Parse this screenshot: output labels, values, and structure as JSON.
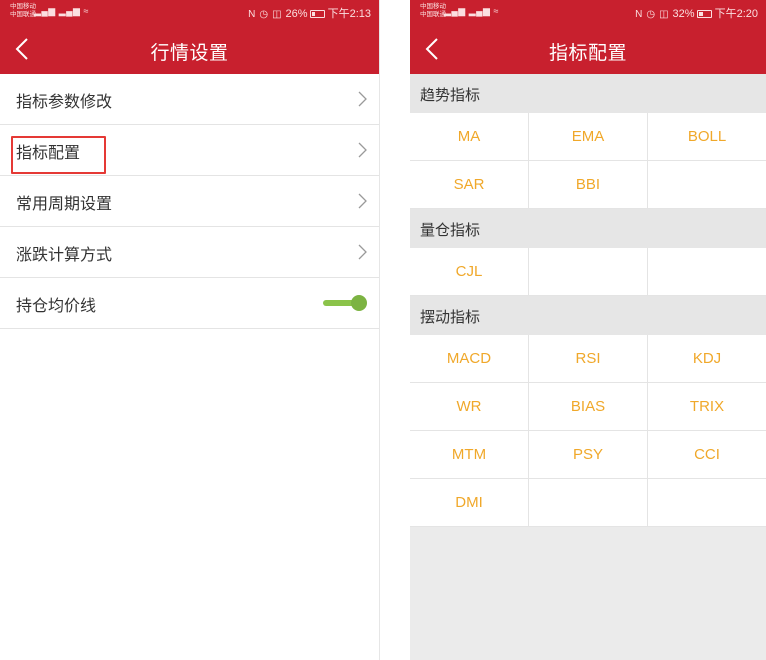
{
  "accent_color": "#c8202e",
  "indicator_color": "#f0a82a",
  "toggle_color": "#7cb342",
  "left_screen": {
    "status": {
      "carrier_1": "中国移动",
      "carrier_2": "中国联通",
      "signal": "▂▄▆ ▂▄▆ ≈",
      "battery_level": 0.26,
      "percent": "26%",
      "time": "下午2:13"
    },
    "title": "行情设置",
    "items": [
      {
        "label": "指标参数修改"
      },
      {
        "label": "指标配置",
        "highlighted": true
      },
      {
        "label": "常用周期设置"
      },
      {
        "label": "涨跌计算方式"
      },
      {
        "label": "持仓均价线",
        "toggle_on": true
      }
    ]
  },
  "right_screen": {
    "status": {
      "carrier_1": "中国移动",
      "carrier_2": "中国联通",
      "signal": "▂▄▆ ▂▄▆ ≈",
      "battery_level": 0.32,
      "percent": "32%",
      "time": "下午2:20"
    },
    "title": "指标配置",
    "sections": [
      {
        "title": "趋势指标",
        "rows": [
          [
            "MA",
            "EMA",
            "BOLL"
          ],
          [
            "SAR",
            "BBI",
            ""
          ]
        ]
      },
      {
        "title": "量仓指标",
        "rows": [
          [
            "CJL",
            "",
            ""
          ]
        ]
      },
      {
        "title": "摆动指标",
        "rows": [
          [
            "MACD",
            "RSI",
            "KDJ"
          ],
          [
            "WR",
            "BIAS",
            "TRIX"
          ],
          [
            "MTM",
            "PSY",
            "CCI"
          ],
          [
            "DMI",
            "",
            ""
          ]
        ]
      }
    ]
  }
}
